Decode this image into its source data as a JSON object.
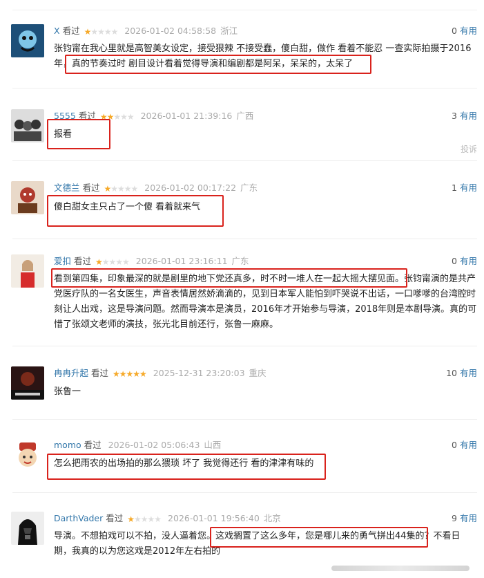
{
  "useful_label": "有用",
  "report_label": "投诉",
  "reviews": [
    {
      "user": "X",
      "status": "看过",
      "rating": 1,
      "time": "2026-01-02 04:58:58",
      "location": "浙江",
      "useful": "0",
      "content": "张钧甯在我心里就是高智美女设定，接受狠辣 不接受蠢，傻白甜，做作 看着不能忍 一查实际拍摄于2016年，真的节奏过时 剧目设计看着觉得导演和编剧都是阿呆，呆呆的，太呆了",
      "avatar_color": "#2e6fa0"
    },
    {
      "user": "5555",
      "status": "看过",
      "rating": 2,
      "time": "2026-01-01 21:39:16",
      "location": "广西",
      "useful": "3",
      "content": "报看",
      "avatar_color": "#666"
    },
    {
      "user": "文德兰",
      "status": "看过",
      "rating": 1,
      "time": "2026-01-02 00:17:22",
      "location": "广东",
      "useful": "1",
      "content": "傻白甜女主只占了一个傻 看着就来气",
      "avatar_color": "#b03a2e"
    },
    {
      "user": "爱扣",
      "status": "看过",
      "rating": 1,
      "time": "2026-01-01 23:16:11",
      "location": "广东",
      "useful": "0",
      "content": "看到第四集，印象最深的就是剧里的地下党还真多，时不时一堆人在一起大摇大摆见面。张钧甯演的是共产党医疗队的一名女医生，声音表情居然娇滴滴的，见到日本军人能怕到吓哭说不出话，一口嗲嗲的台湾腔时刻让人出戏，这是导演问题。然而导演本是演员，2016年才开始参与导演，2018年则是本剧导演。真的可惜了张颂文老师的演技，张光北目前还行，张鲁一麻麻。",
      "avatar_color": "#c8a07a"
    },
    {
      "user": "冉冉升起",
      "status": "看过",
      "rating": 5,
      "time": "2025-12-31 23:20:03",
      "location": "重庆",
      "useful": "10",
      "content": "张鲁一",
      "avatar_color": "#3a1f1f"
    },
    {
      "user": "momo",
      "status": "看过",
      "rating": 0,
      "time": "2026-01-02 05:06:43",
      "location": "山西",
      "useful": "0",
      "content": "怎么把雨农的出场拍的那么猥琐 坏了 我觉得还行 看的津津有味的",
      "avatar_color": "#f3c15a"
    },
    {
      "user": "DarthVader",
      "status": "看过",
      "rating": 1,
      "time": "2026-01-01 19:56:40",
      "location": "北京",
      "useful": "9",
      "content": "导演。不想拍戏可以不拍，没人逼着您。这戏搁置了这么多年，您是哪儿来的勇气拼出44集的？不看日期，我真的以为您这戏是2012年左右拍的",
      "avatar_color": "#222"
    }
  ]
}
